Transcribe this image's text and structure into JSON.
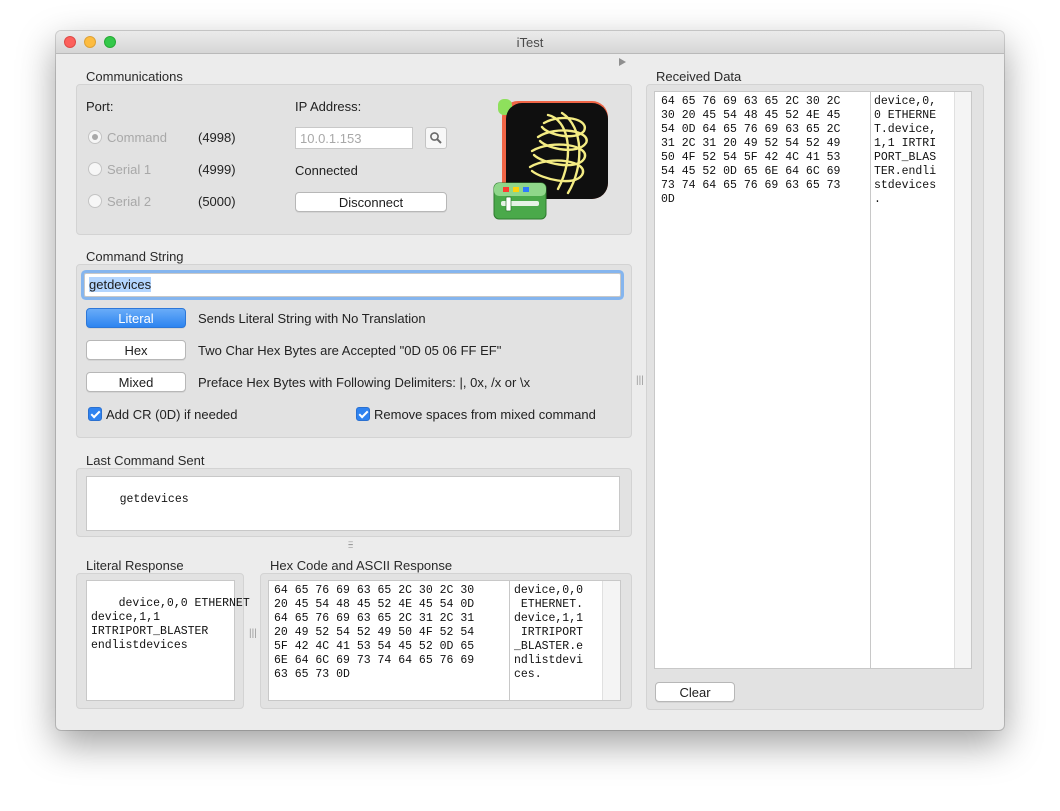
{
  "window": {
    "title": "iTest"
  },
  "communications": {
    "title": "Communications",
    "port_label": "Port:",
    "ports": [
      {
        "label": "Command",
        "number": "(4998)",
        "selected": true
      },
      {
        "label": "Serial 1",
        "number": "(4999)",
        "selected": false
      },
      {
        "label": "Serial 2",
        "number": "(5000)",
        "selected": false
      }
    ],
    "ip_label": "IP Address:",
    "ip_value": "10.0.1.153",
    "status": "Connected",
    "disconnect_label": "Disconnect"
  },
  "command_string": {
    "title": "Command String",
    "value": "getdevices",
    "modes": [
      {
        "label": "Literal",
        "desc": "Sends Literal String with No Translation",
        "selected": true
      },
      {
        "label": "Hex",
        "desc": "Two Char Hex Bytes are Accepted \"0D 05 06 FF EF\"",
        "selected": false
      },
      {
        "label": "Mixed",
        "desc": "Preface Hex Bytes with Following Delimiters: |, 0x, /x or \\x",
        "selected": false
      }
    ],
    "add_cr_label": "Add CR (0D) if needed",
    "remove_spaces_label": "Remove spaces from mixed command"
  },
  "last_command": {
    "title": "Last Command Sent",
    "value": "getdevices"
  },
  "literal_response": {
    "title": "Literal Response",
    "text": "device,0,0 ETHERNET\ndevice,1,1\nIRTRIPORT_BLASTER\nendlistdevices"
  },
  "hex_response": {
    "title": "Hex Code and ASCII Response",
    "hex": "64 65 76 69 63 65 2C 30 2C 30\n20 45 54 48 45 52 4E 45 54 0D\n64 65 76 69 63 65 2C 31 2C 31\n20 49 52 54 52 49 50 4F 52 54\n5F 42 4C 41 53 54 45 52 0D 65\n6E 64 6C 69 73 74 64 65 76 69\n63 65 73 0D",
    "ascii": "device,0,0\n ETHERNET.\ndevice,1,1\n IRTRIPORT\n_BLASTER.e\nndlistdevi\nces."
  },
  "received": {
    "title": "Received Data",
    "hex": "64 65 76 69 63 65 2C 30 2C\n30 20 45 54 48 45 52 4E 45\n54 0D 64 65 76 69 63 65 2C\n31 2C 31 20 49 52 54 52 49\n50 4F 52 54 5F 42 4C 41 53\n54 45 52 0D 65 6E 64 6C 69\n73 74 64 65 76 69 63 65 73\n0D",
    "ascii": "device,0,\n0 ETHERNE\nT.device,\n1,1 IRTRI\nPORT_BLAS\nTER.endli\nstdevices\n.",
    "clear_label": "Clear"
  },
  "icons": {
    "search": "magnifier-icon",
    "app": "itest-app-icon",
    "disclosure": "disclosure-triangle-icon"
  }
}
